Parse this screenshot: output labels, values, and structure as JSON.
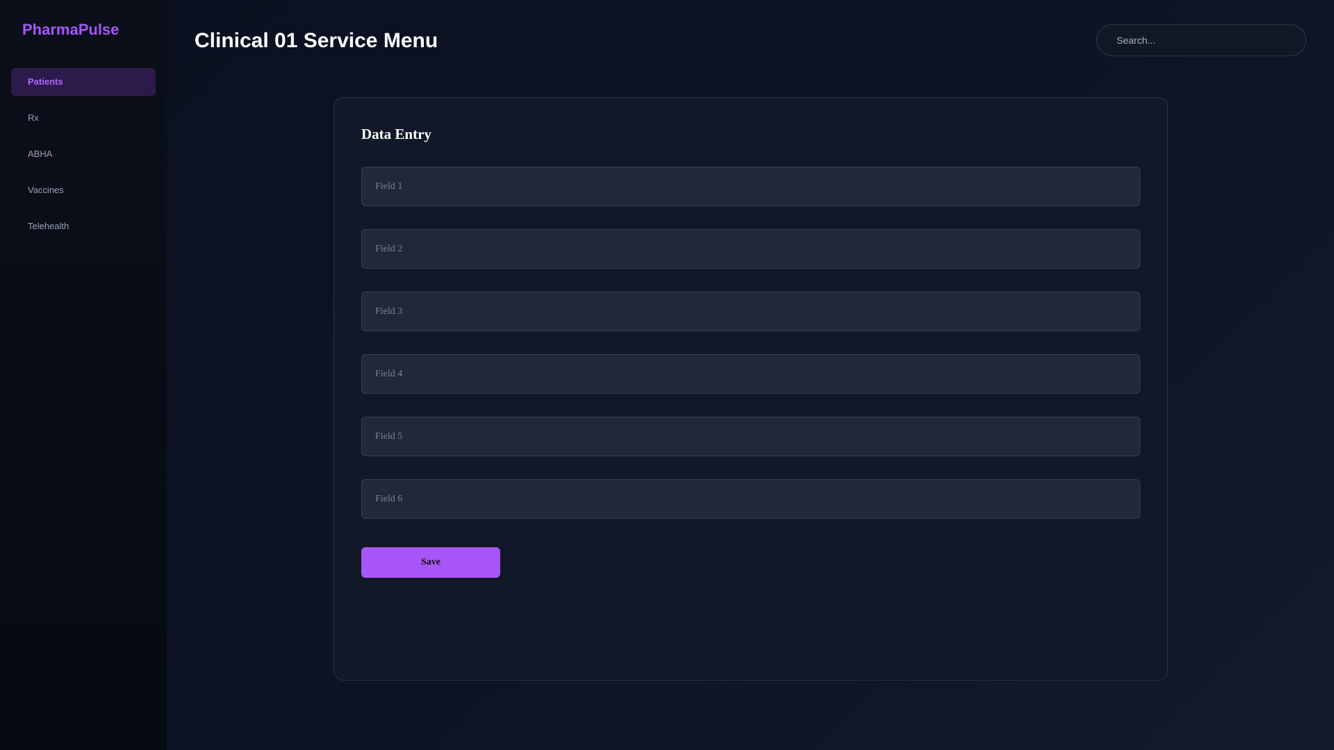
{
  "app": {
    "brand": "PharmaPulse"
  },
  "sidebar": {
    "items": [
      {
        "label": "Patients",
        "active": true
      },
      {
        "label": "Rx",
        "active": false
      },
      {
        "label": "ABHA",
        "active": false
      },
      {
        "label": "Vaccines",
        "active": false
      },
      {
        "label": "Telehealth",
        "active": false
      }
    ]
  },
  "header": {
    "title": "Clinical 01 Service Menu",
    "search_placeholder": "Search..."
  },
  "form": {
    "title": "Data Entry",
    "fields": [
      {
        "placeholder": "Field 1",
        "value": ""
      },
      {
        "placeholder": "Field 2",
        "value": ""
      },
      {
        "placeholder": "Field 3",
        "value": ""
      },
      {
        "placeholder": "Field 4",
        "value": ""
      },
      {
        "placeholder": "Field 5",
        "value": ""
      },
      {
        "placeholder": "Field 6",
        "value": ""
      }
    ],
    "save_label": "Save"
  },
  "colors": {
    "accent": "#a855f7",
    "active_nav_bg": "#2c1b4a",
    "background": "#0b1120",
    "card_bg": "#111827",
    "field_bg": "#1f2937"
  }
}
